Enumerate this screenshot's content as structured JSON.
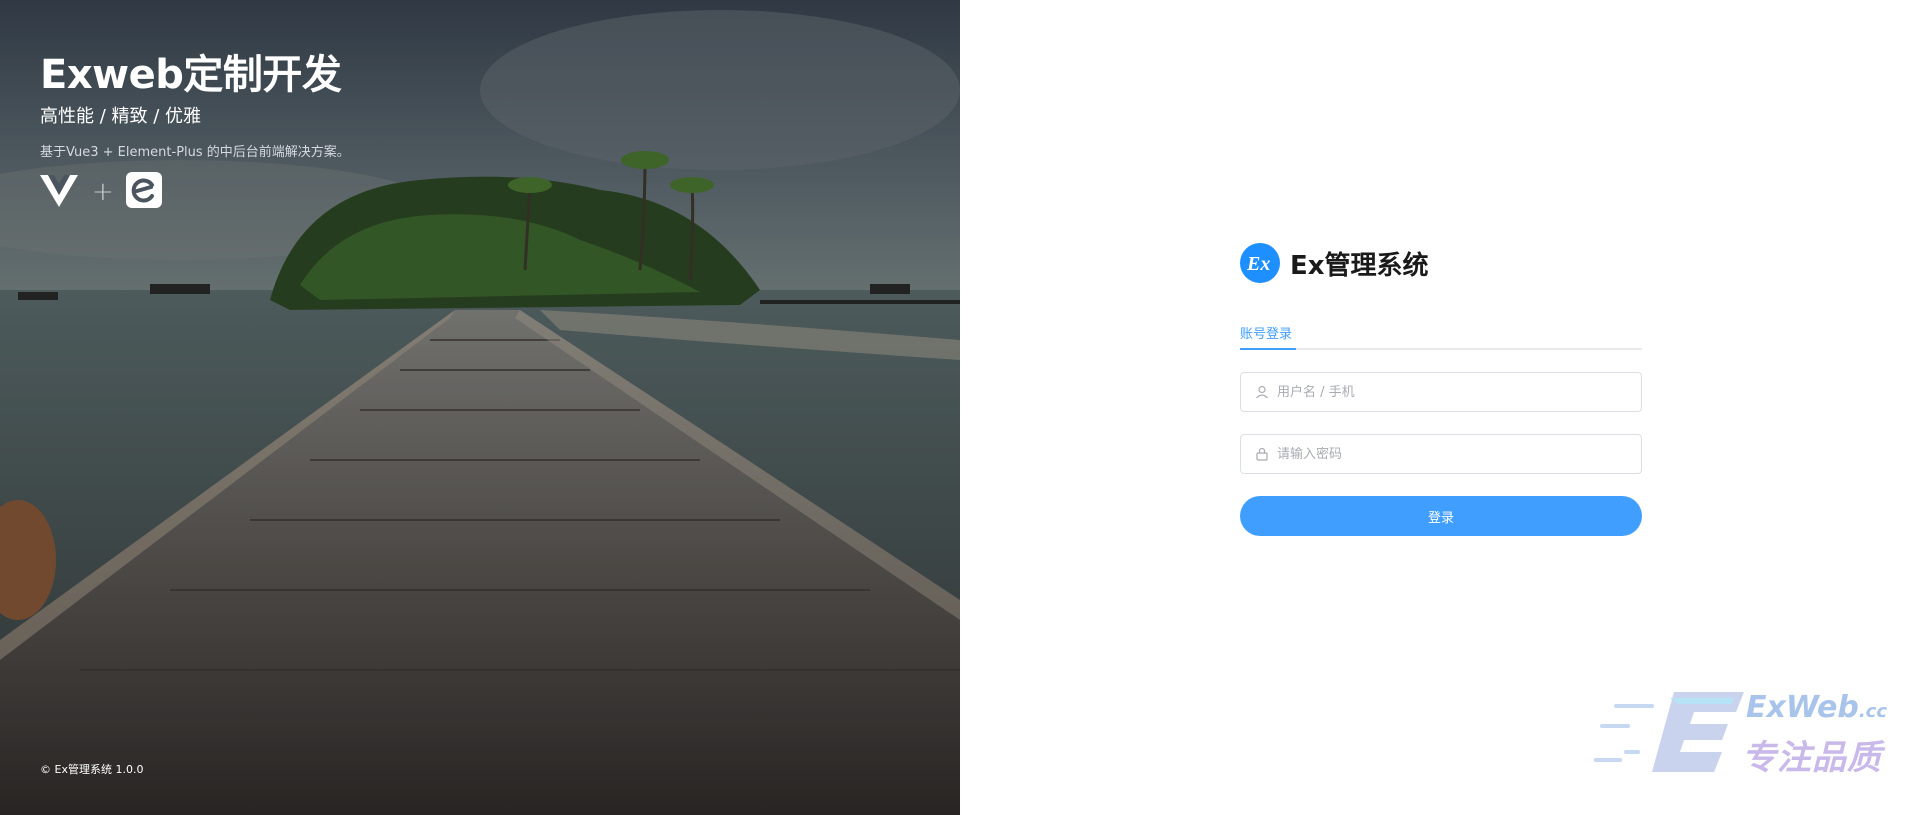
{
  "hero": {
    "title": "Exweb定制开发",
    "subtitle": "高性能 / 精致 / 优雅",
    "description": "基于Vue3 + Element-Plus 的中后台前端解决方案。",
    "tech_icons": [
      "vue-icon",
      "element-plus-icon"
    ],
    "plus_sign": "+",
    "footer": "© Ex管理系统 1.0.0"
  },
  "login": {
    "brand_logo_text": "Ex",
    "brand_name": "Ex管理系统",
    "tab_label": "账号登录",
    "username_placeholder": "用户名 / 手机",
    "password_placeholder": "请输入密码",
    "submit_label": "登录",
    "accent_color": "#409eff"
  },
  "watermark": {
    "latin": "ExWeb",
    "latin_suffix": ".cc",
    "chinese": "专注品质"
  }
}
